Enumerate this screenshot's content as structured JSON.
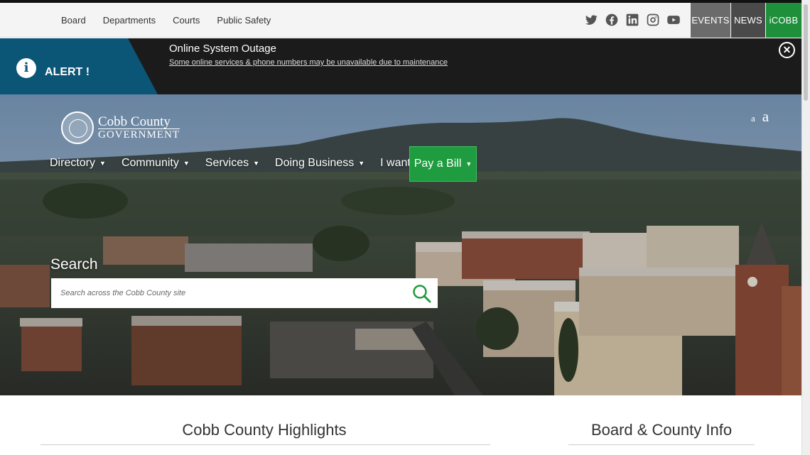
{
  "topbar": {
    "links": [
      "Board",
      "Departments",
      "Courts",
      "Public Safety"
    ],
    "social_icons": [
      "twitter-icon",
      "facebook-icon",
      "linkedin-icon",
      "instagram-icon",
      "youtube-icon"
    ],
    "buttons": [
      {
        "label": "EVENTS",
        "color": "#6b6b6b"
      },
      {
        "label": "NEWS",
        "color": "#4a4a4a"
      },
      {
        "label": "iCOBB",
        "color": "#1e8f3a"
      }
    ]
  },
  "alert": {
    "label": "ALERT !",
    "title": "Online System Outage",
    "subtitle": "Some online services & phone numbers may be unavailable due to maintenance",
    "accent": "#0b5577"
  },
  "logo": {
    "line1": "Cobb County",
    "line2": "GOVERNMENT"
  },
  "text_size": {
    "small": "a",
    "large": "a"
  },
  "nav": {
    "items": [
      "Directory",
      "Community",
      "Services",
      "Doing Business",
      "I want to..."
    ],
    "pay_bill": "Pay a Bill",
    "pay_bill_color": "#1e9c3f"
  },
  "search": {
    "label": "Search",
    "placeholder": "Search across the Cobb County site",
    "icon_color": "#1e9c3f"
  },
  "sections": {
    "highlights": "Cobb County Highlights",
    "board_info": "Board & County Info"
  }
}
